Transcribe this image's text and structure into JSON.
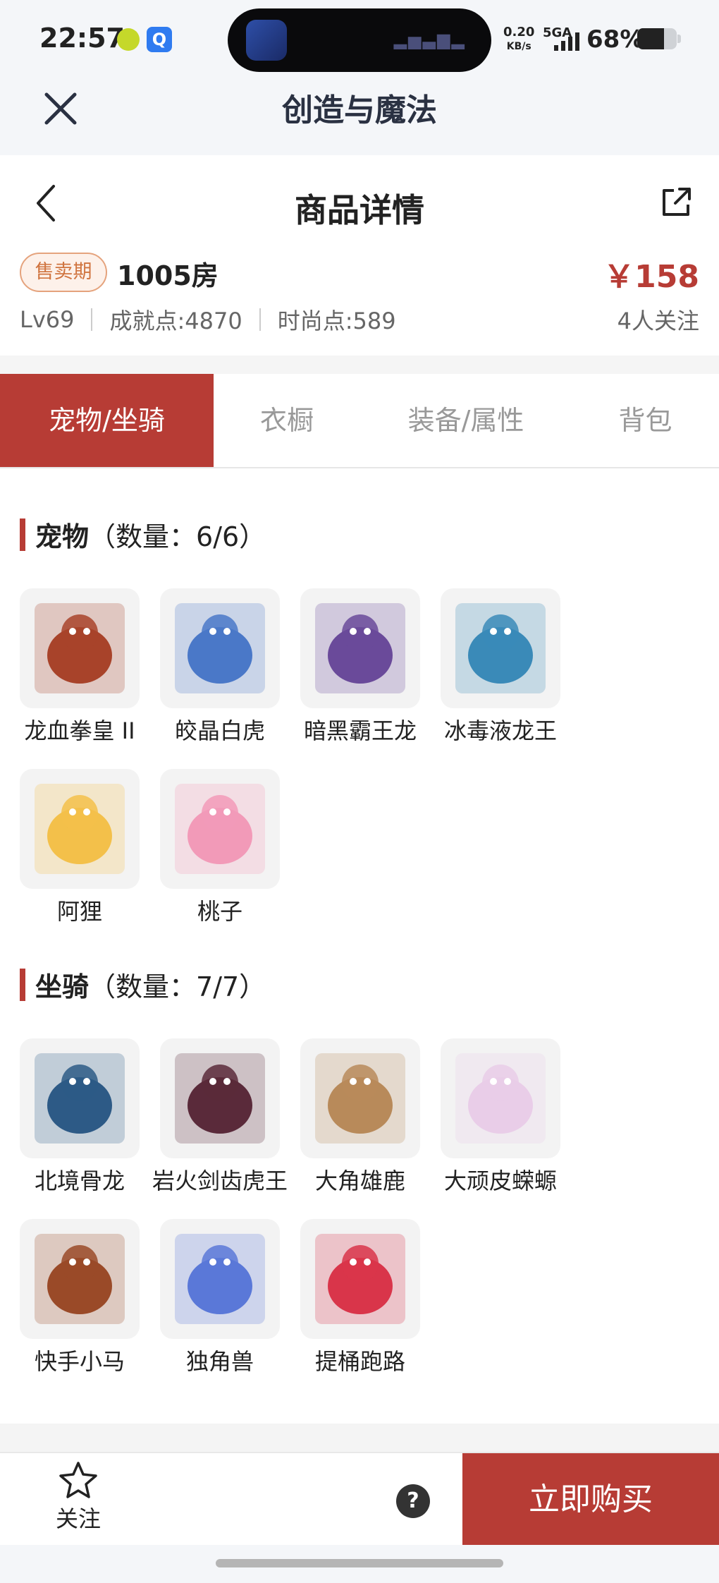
{
  "status_bar": {
    "time": "22:57",
    "app_icons": [
      "green-app-icon",
      "blue-q-app-icon"
    ],
    "app2_glyph": "Q",
    "island_app_icon": "game-app-icon",
    "net_speed_value": "0.20",
    "net_speed_unit": "KB/s",
    "network": "5GA",
    "battery_text": "68%",
    "battery_level": 0.68,
    "signal_level": 4
  },
  "app_bar": {
    "close_icon": "close-icon",
    "title": "创造与魔法"
  },
  "nav": {
    "back_icon": "chevron-left-icon",
    "title": "商品详情",
    "share_icon": "share-icon"
  },
  "product": {
    "badge": "售卖期",
    "room": "1005房",
    "price": "￥158",
    "level": "Lv69",
    "achievement": "成就点:4870",
    "fashion": "时尚点:589",
    "followers": "4人关注"
  },
  "tabs": [
    {
      "label": "宠物/坐骑",
      "active": true
    },
    {
      "label": "衣橱",
      "active": false
    },
    {
      "label": "装备/属性",
      "active": false
    },
    {
      "label": "背包",
      "active": false
    }
  ],
  "pets": {
    "title": "宠物",
    "count": "（数量：6/6）",
    "items": [
      {
        "name": "龙血拳皇 II",
        "color": "#a8432a"
      },
      {
        "name": "皎晶白虎",
        "color": "#4a78c8"
      },
      {
        "name": "暗黑霸王龙",
        "color": "#6a4a9a"
      },
      {
        "name": "冰毒液龙王",
        "color": "#3a8ab8"
      },
      {
        "name": "阿狸",
        "color": "#f3c04a"
      },
      {
        "name": "桃子",
        "color": "#f29ab8"
      }
    ]
  },
  "mounts": {
    "title": "坐骑",
    "count": "（数量：7/7）",
    "items": [
      {
        "name": "北境骨龙",
        "color": "#2d5a86"
      },
      {
        "name": "岩火剑齿虎王",
        "color": "#5a2a3a"
      },
      {
        "name": "大角雄鹿",
        "color": "#b88a5a"
      },
      {
        "name": "大顽皮蝾螈",
        "color": "#e9cde8"
      },
      {
        "name": "快手小马",
        "color": "#9a4a28"
      },
      {
        "name": "独角兽",
        "color": "#5a78d8"
      },
      {
        "name": "提桶跑路",
        "color": "#d9354a"
      }
    ]
  },
  "bottom": {
    "fav_icon": "star-icon",
    "fav_label": "关注",
    "help_icon": "question-icon",
    "help_glyph": "?",
    "buy_label": "立即购买"
  }
}
